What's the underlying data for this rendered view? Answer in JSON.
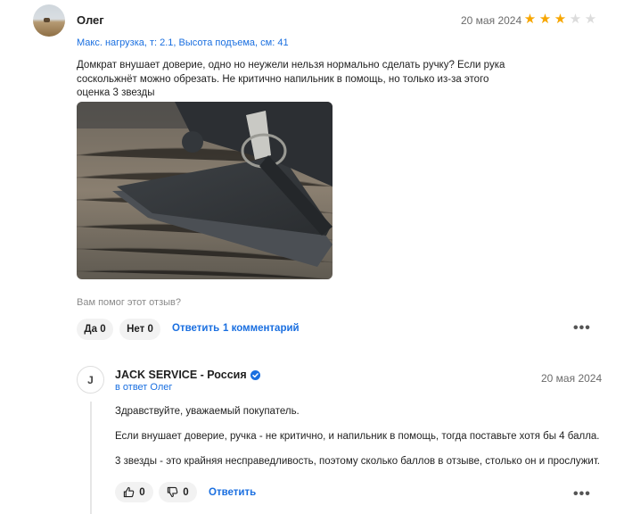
{
  "review": {
    "author": "Олег",
    "date": "20 мая 2024",
    "rating": 3,
    "rating_max": 5,
    "specs": "Макс. нагрузка, т: 2.1, Высота подъема, см: 41",
    "text": "Домкрат внушает доверие, одно но неужели нельзя нормально сделать ручку? Если рука соскольжнёт можно обрезать. Не критично напильник в помощь, но только из-за этого оценка 3 звезды",
    "helpful_question": "Вам помог этот отзыв?",
    "yes_label": "Да 0",
    "no_label": "Нет 0",
    "reply_label": "Ответить",
    "comments_label": "1 комментарий",
    "more_label": "•••"
  },
  "reply": {
    "avatar_letter": "J",
    "seller_name": "JACK SERVICE - Россия",
    "in_reply_to": "в ответ Олег",
    "date": "20 мая 2024",
    "paragraphs": [
      "Здравствуйте, уважаемый покупатель.",
      "Если внушает доверие, ручка - не критично, и напильник в помощь, тогда поставьте хотя бы 4 балла.",
      "3 звезды - это крайняя несправедливость, поэтому сколько баллов в отзыве, столько он и прослужит."
    ],
    "likes": "0",
    "dislikes": "0",
    "reply_label": "Ответить",
    "more_label": "•••"
  },
  "colors": {
    "accent_link": "#1a6fe0",
    "star_on": "#f7a600",
    "star_off": "#dcdcdc",
    "verified": "#1a6fe0"
  }
}
